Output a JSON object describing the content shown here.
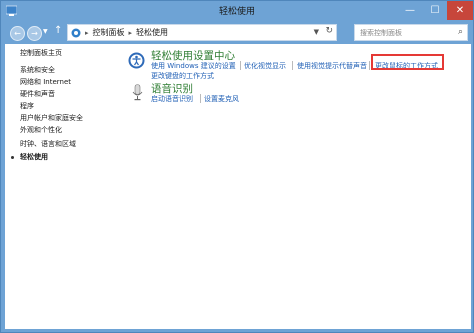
{
  "window": {
    "title": "轻松使用"
  },
  "address": {
    "crumbs": [
      "控制面板",
      "轻松使用"
    ],
    "search_placeholder": "搜索控制面板"
  },
  "sidebar": {
    "items": [
      {
        "label": "控制面板主页"
      },
      {
        "label": "系统和安全"
      },
      {
        "label": "网络和 Internet"
      },
      {
        "label": "硬件和声音"
      },
      {
        "label": "程序"
      },
      {
        "label": "用户帐户和家庭安全"
      },
      {
        "label": "外观和个性化"
      },
      {
        "label": "时钟、语言和区域"
      },
      {
        "label": "轻松使用"
      }
    ]
  },
  "categories": [
    {
      "title": "轻松使用设置中心",
      "links": [
        "使用 Windows 建议的设置",
        "优化视觉显示",
        "使用视觉提示代替声音",
        "更改鼠标的工作方式",
        "更改键盘的工作方式"
      ]
    },
    {
      "title": "语音识别",
      "links": [
        "启动语音识别",
        "设置麦克风"
      ]
    }
  ],
  "colors": {
    "accent_green": "#2e7d32",
    "link_blue": "#1f5fb5",
    "highlight_red": "#e53935"
  }
}
